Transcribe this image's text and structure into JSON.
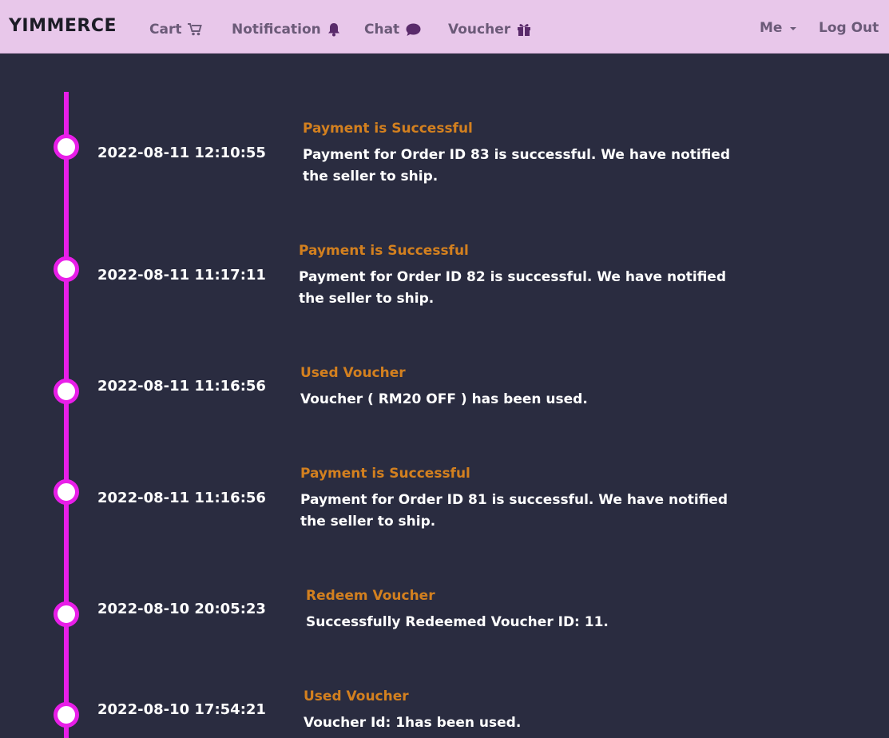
{
  "nav": {
    "brand": "YIMMERCE",
    "cart_label": "Cart",
    "notification_label": "Notification",
    "chat_label": "Chat",
    "voucher_label": "Voucher",
    "me_label": "Me",
    "logout_label": "Log Out"
  },
  "colors": {
    "navbar_bg": "#e8c7ea",
    "page_bg": "#2a2c40",
    "timeline": "#e81ee8",
    "event_title": "#d3801f",
    "nav_text": "#6b5a78"
  },
  "events": [
    {
      "date": "2022-08-11 12:10:55",
      "title": "Payment is Successful",
      "body": "Payment for Order ID 83 is successful. We have notified the seller to ship."
    },
    {
      "date": "2022-08-11 11:17:11",
      "title": "Payment is Successful",
      "body": "Payment for Order ID 82 is successful. We have notified the seller to ship."
    },
    {
      "date": "2022-08-11 11:16:56",
      "title": "Used Voucher",
      "body": "Voucher ( RM20 OFF ) has been used."
    },
    {
      "date": "2022-08-11 11:16:56",
      "title": "Payment is Successful",
      "body": "Payment for Order ID 81 is successful. We have notified the seller to ship."
    },
    {
      "date": "2022-08-10 20:05:23",
      "title": "Redeem Voucher",
      "body": "Successfully Redeemed Voucher ID: 11."
    },
    {
      "date": "2022-08-10 17:54:21",
      "title": "Used Voucher",
      "body": "Voucher Id: 1has been used."
    }
  ]
}
